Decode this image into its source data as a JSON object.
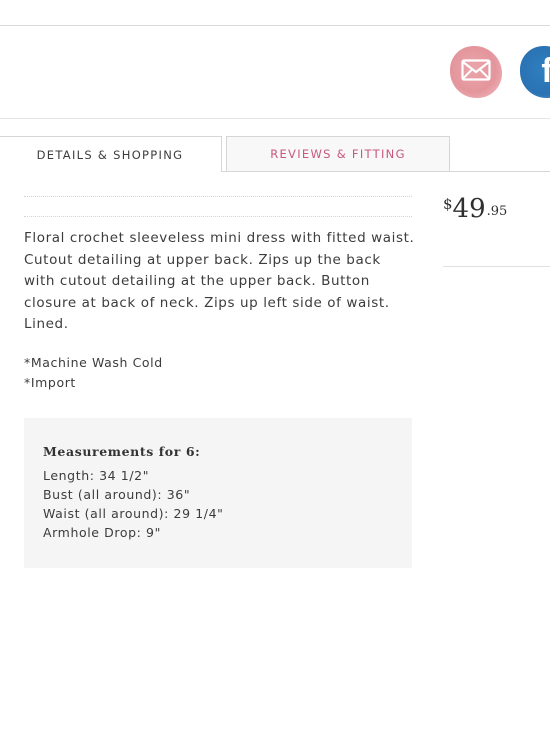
{
  "share": {
    "email_icon": "envelope-icon",
    "facebook_icon": "facebook-icon",
    "facebook_glyph": "f",
    "colors": {
      "email": "#e4959c",
      "facebook": "#2a72b3"
    }
  },
  "tabs": [
    {
      "label": "DETAILS & SHOPPING",
      "active": true
    },
    {
      "label": "REVIEWS & FITTING",
      "active": false,
      "color": "#c7587e"
    }
  ],
  "product": {
    "price": {
      "currency": "$",
      "dollars": "49",
      "cents": ".95"
    },
    "description": "Floral crochet sleeveless mini dress with fitted waist. Cutout detailing at upper back. Zips up the back with cutout detailing at the upper back. Button closure at back of neck. Zips up left side of waist. Lined.",
    "care": [
      "*Machine Wash Cold",
      "*Import"
    ]
  },
  "measurements": {
    "title": "Measurements for 6:",
    "items": [
      "Length: 34 1/2\"",
      "Bust (all around): 36\"",
      "Waist (all around): 29 1/4\"",
      "Armhole Drop: 9\""
    ]
  }
}
